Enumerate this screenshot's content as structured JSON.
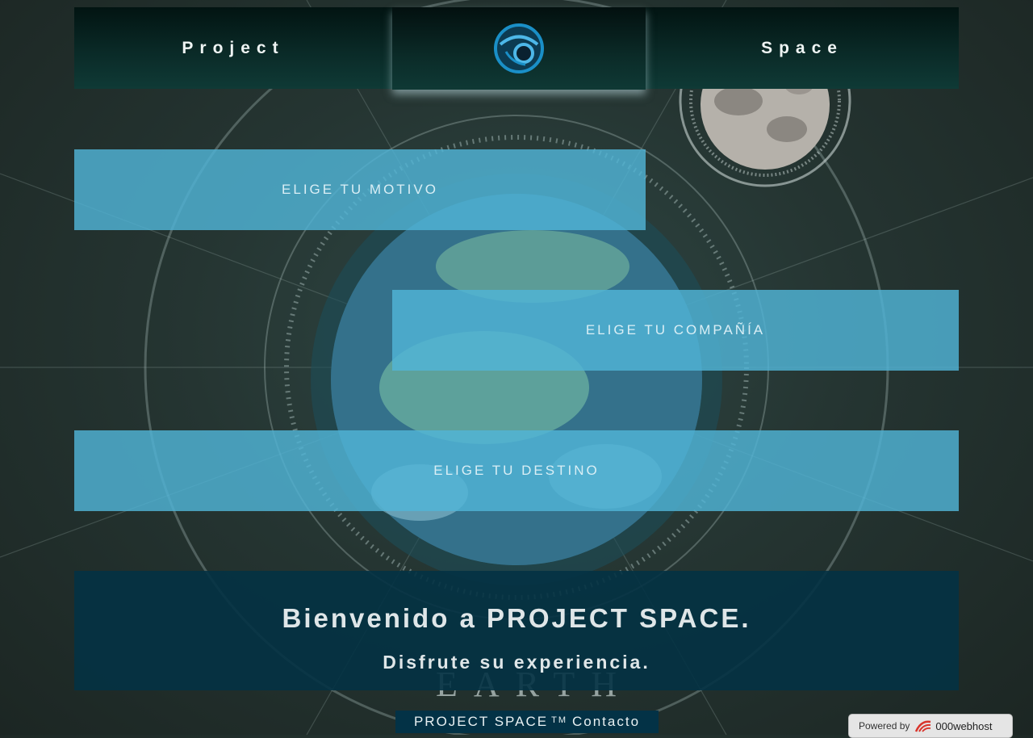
{
  "header": {
    "left_label": "Project",
    "right_label": "Space",
    "logo_icon": "project-space-logo-icon"
  },
  "options": [
    {
      "label": "ELIGE TU MOTIVO"
    },
    {
      "label": "ELIGE TU COMPAÑÍA"
    },
    {
      "label": "ELIGE TU DESTINO"
    }
  ],
  "welcome": {
    "title": "Bienvenido a PROJECT SPACE.",
    "subtitle": "Disfrute su experiencia."
  },
  "background": {
    "planet_caption": "EARTH"
  },
  "footer": {
    "brand": "PROJECT SPACE",
    "trademark": "TM",
    "contact_link": "Contacto"
  },
  "powered_by": {
    "prefix": "Powered by",
    "brand": "000webhost"
  },
  "colors": {
    "band": "#50b4d7",
    "welcome_panel": "#033244",
    "header": "#0a2a27"
  }
}
